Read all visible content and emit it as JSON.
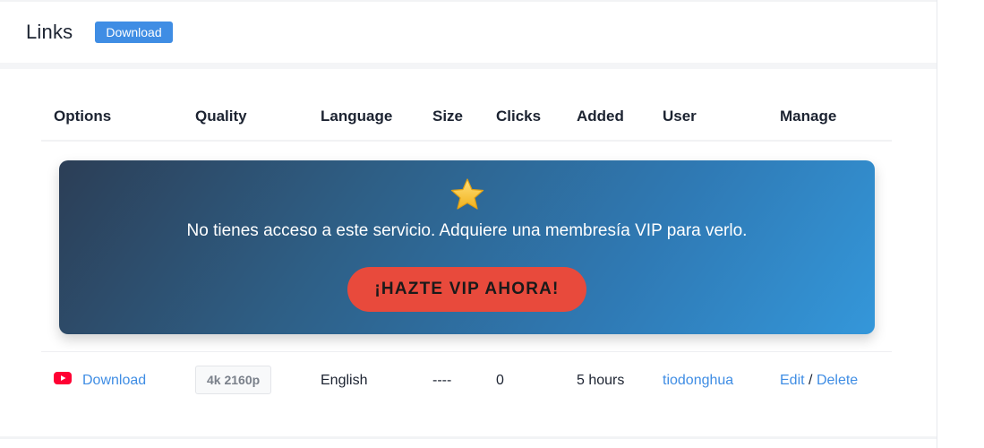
{
  "header": {
    "title": "Links",
    "download_label": "Download"
  },
  "table": {
    "columns": [
      "Options",
      "Quality",
      "Language",
      "Size",
      "Clicks",
      "Added",
      "User",
      "Manage"
    ]
  },
  "vip": {
    "icon": "star-icon",
    "message": "No tienes acceso a este servicio. Adquiere una membresía VIP para verlo.",
    "button_label": "¡HAZTE VIP AHORA!"
  },
  "rows": [
    {
      "option_icon": "youtube-icon",
      "option_label": "Download",
      "quality": "4k 2160p",
      "language": "English",
      "size": "----",
      "clicks": "0",
      "added": "5 hours",
      "user": "tiodonghua",
      "edit_label": "Edit",
      "separator": "/",
      "delete_label": "Delete"
    }
  ],
  "colors": {
    "accent": "#3f8de4",
    "vip_button": "#e84a3c",
    "youtube": "#ff0033"
  }
}
